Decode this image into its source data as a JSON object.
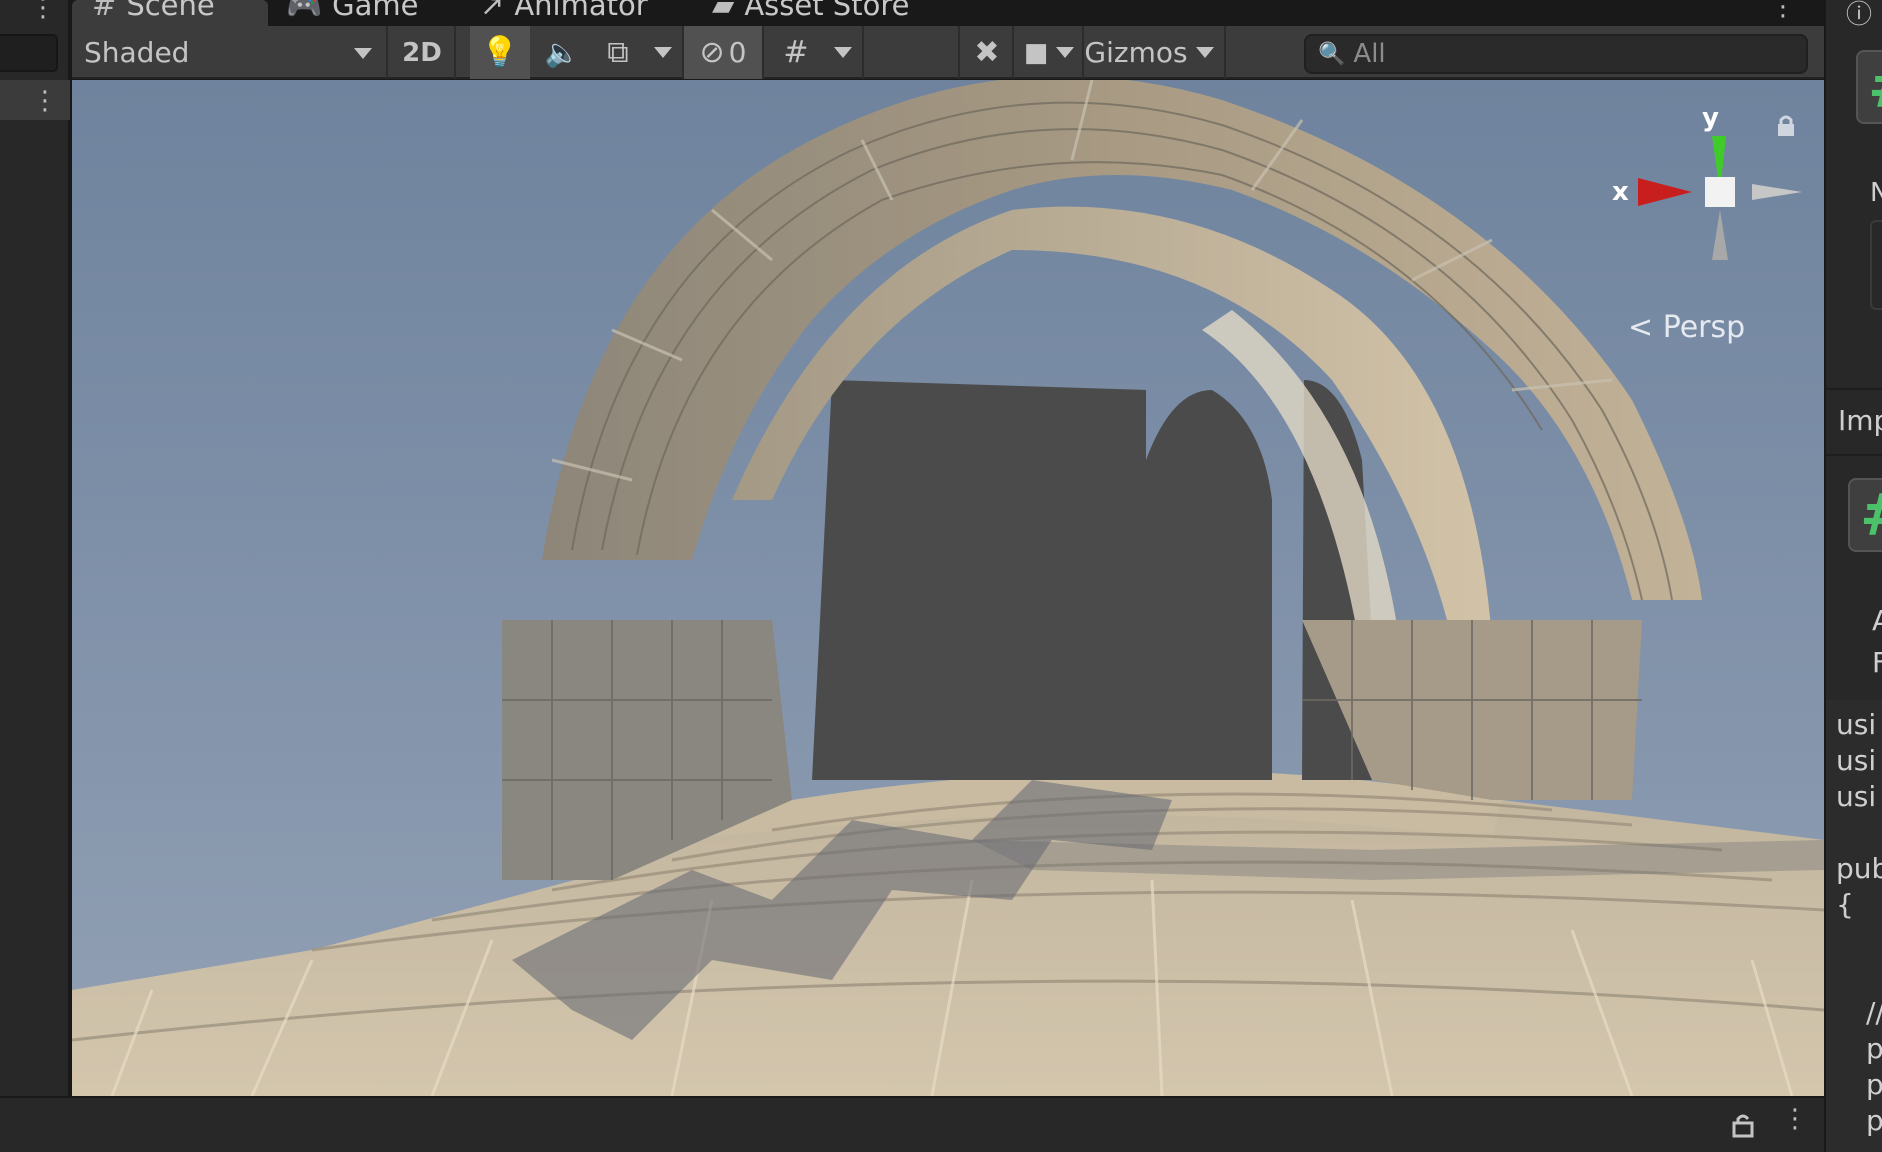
{
  "tabs": [
    {
      "label": "Scene",
      "icon": "hash-icon"
    },
    {
      "label": "Game",
      "icon": "gamepad-icon"
    },
    {
      "label": "Animator",
      "icon": "animator-icon"
    },
    {
      "label": "Asset Store",
      "icon": "store-bag-icon"
    }
  ],
  "toolbar": {
    "draw_mode": "Shaded",
    "two_d_label": "2D",
    "hidden_count": "0",
    "gizmos_label": "Gizmos",
    "search_placeholder": "All"
  },
  "viewport": {
    "projection_label": "Persp",
    "axis_x_label": "x",
    "axis_y_label": "y",
    "colors": {
      "sky": "#7b8ea8",
      "axis_x": "#c81e1e",
      "axis_y": "#3fcc2a",
      "stone": "#b3a48c",
      "shadow_blocks": "#4b4b4b"
    }
  },
  "inspector": {
    "hash_glyph": "#",
    "label_imp": "Imp",
    "label_a": "A",
    "label_f": "F",
    "code_lines": [
      "usi",
      "usi",
      "usi",
      "",
      "pub",
      "{",
      "",
      "",
      "//",
      "p",
      "p",
      "p"
    ]
  }
}
